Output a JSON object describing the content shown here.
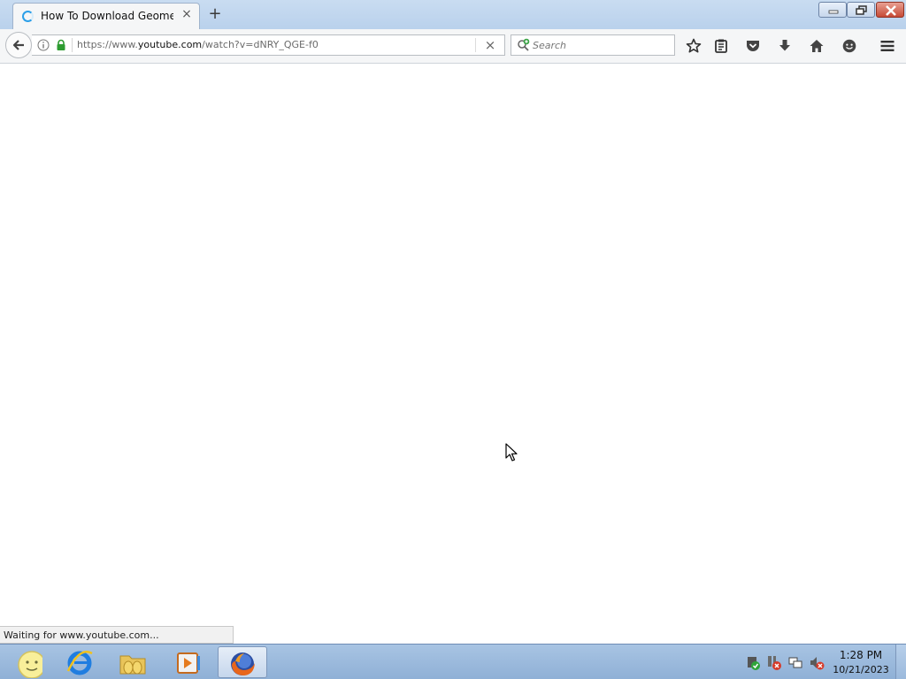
{
  "browser": {
    "tab": {
      "title": "How To Download Geome...",
      "close_label": "×"
    },
    "new_tab_label": "+",
    "window_buttons": [
      "minimize",
      "restore",
      "close"
    ]
  },
  "navbar": {
    "url_prefix": "https://www.",
    "url_domain": "youtube.com",
    "url_path": "/watch?v=dNRY_QGE-f0",
    "clear_label": "×",
    "search_placeholder": "Search",
    "icons": [
      "star-icon",
      "reading-list-icon",
      "pocket-icon",
      "download-icon",
      "home-icon",
      "chat-icon",
      "menu-icon"
    ]
  },
  "status": {
    "text": "Waiting for www.youtube.com..."
  },
  "taskbar": {
    "apps": [
      "start-orb-icon",
      "internet-explorer-icon",
      "folder-icon",
      "media-player-icon",
      "firefox-icon"
    ],
    "active_app": "firefox-icon",
    "tray_icons": [
      "security-icon",
      "network-error-icon",
      "network-icon",
      "volume-muted-icon"
    ],
    "clock_time": "1:28 PM",
    "clock_date": "10/21/2023"
  },
  "colors": {
    "accent": "#2b9fe8",
    "taskbar": "#9fbde0"
  }
}
